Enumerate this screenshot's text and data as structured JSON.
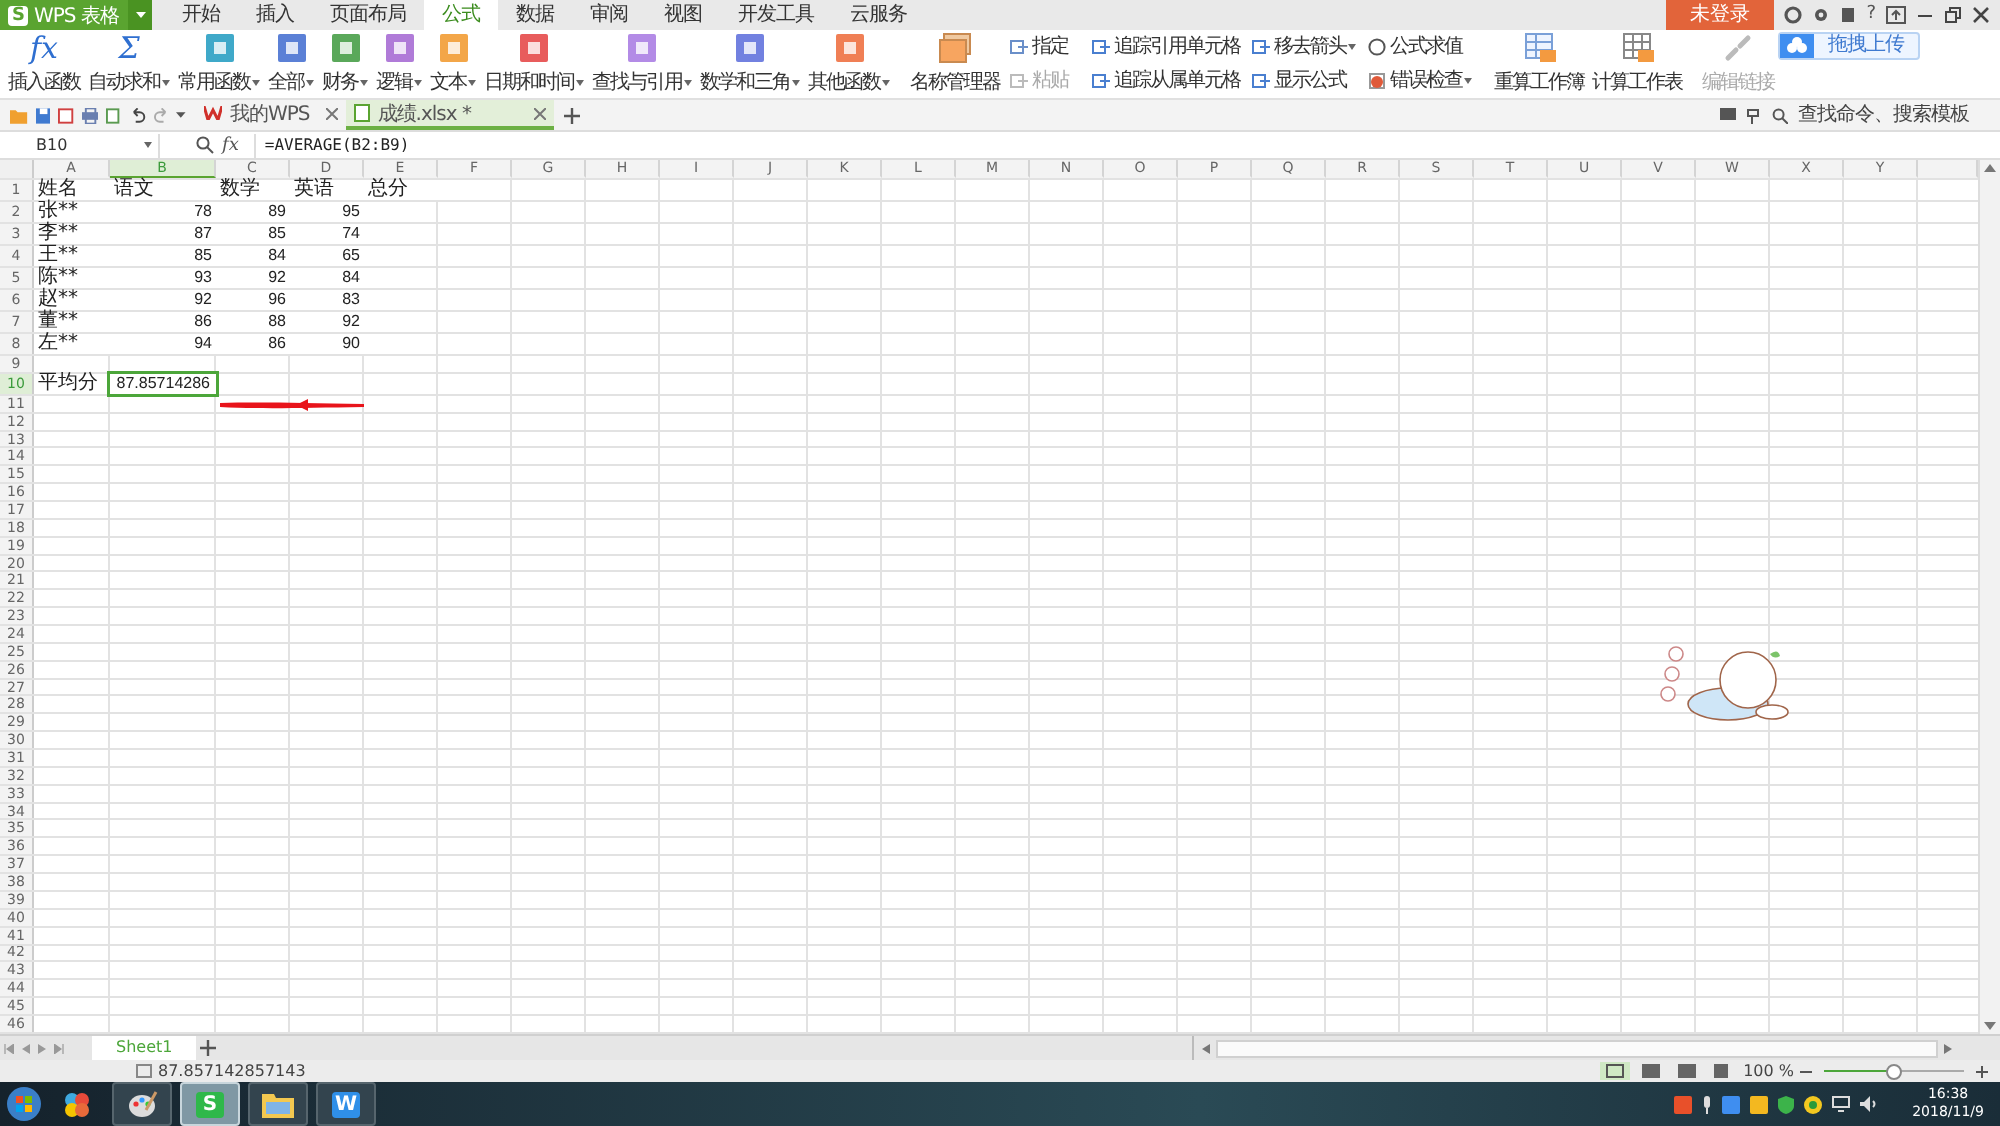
{
  "title_bar": {
    "brand_glyph": "S",
    "brand": "WPS 表格",
    "login": "未登录",
    "help": "?"
  },
  "menu_tabs": [
    {
      "label": "开始",
      "selected": false
    },
    {
      "label": "插入",
      "selected": false
    },
    {
      "label": "页面布局",
      "selected": false
    },
    {
      "label": "公式",
      "selected": true
    },
    {
      "label": "数据",
      "selected": false
    },
    {
      "label": "审阅",
      "selected": false
    },
    {
      "label": "视图",
      "selected": false
    },
    {
      "label": "开发工具",
      "selected": false
    },
    {
      "label": "云服务",
      "selected": false
    }
  ],
  "ribbon": [
    {
      "kind": "symbol",
      "icon_text": "fx",
      "label": "插入函数",
      "dropdown": false,
      "disabled": false
    },
    {
      "kind": "symbol",
      "icon_text": "Σ",
      "label": "自动求和",
      "dropdown": true,
      "disabled": false
    },
    {
      "kind": "category",
      "color": "#3fa9c9",
      "label": "常用函数",
      "dropdown": true,
      "disabled": false
    },
    {
      "kind": "category",
      "color": "#5b80d6",
      "label": "全部",
      "dropdown": true,
      "disabled": false
    },
    {
      "kind": "category",
      "color": "#5aa85a",
      "label": "财务",
      "dropdown": true,
      "disabled": false
    },
    {
      "kind": "category",
      "color": "#b07bd8",
      "label": "逻辑",
      "dropdown": true,
      "disabled": false
    },
    {
      "kind": "category",
      "color": "#f3a648",
      "label": "文本",
      "dropdown": true,
      "disabled": false
    },
    {
      "kind": "category",
      "color": "#e85c5c",
      "label": "日期和时间",
      "dropdown": true,
      "disabled": false
    },
    {
      "kind": "category",
      "color": "#b38be6",
      "label": "查找与引用",
      "dropdown": true,
      "disabled": false
    },
    {
      "kind": "category",
      "color": "#7281e0",
      "label": "数学和三角",
      "dropdown": true,
      "disabled": false
    },
    {
      "kind": "category",
      "color": "#f07f55",
      "label": "其他函数",
      "dropdown": true,
      "disabled": false
    },
    {
      "kind": "divider"
    },
    {
      "kind": "names",
      "label": "名称管理器",
      "dropdown": false,
      "disabled": false
    },
    {
      "kind": "stack",
      "items": [
        {
          "kind": "tag",
          "label": "指定",
          "dropdown": false,
          "disabled": false
        },
        {
          "kind": "paste",
          "label": "粘贴",
          "dropdown": false,
          "disabled": true
        }
      ]
    },
    {
      "kind": "divider"
    },
    {
      "kind": "stack",
      "items": [
        {
          "kind": "trace",
          "label": "追踪引用单元格",
          "dropdown": false,
          "disabled": false
        },
        {
          "kind": "trace",
          "label": "追踪从属单元格",
          "dropdown": false,
          "disabled": false
        }
      ]
    },
    {
      "kind": "stack",
      "items": [
        {
          "kind": "remove",
          "label": "移去箭头",
          "dropdown": true,
          "disabled": false
        },
        {
          "kind": "show",
          "label": "显示公式",
          "dropdown": false,
          "disabled": false
        }
      ]
    },
    {
      "kind": "stack",
      "items": [
        {
          "kind": "eval",
          "label": "公式求值",
          "dropdown": false,
          "disabled": false
        },
        {
          "kind": "error",
          "label": "错误检查",
          "dropdown": true,
          "disabled": false
        }
      ]
    },
    {
      "kind": "divider"
    },
    {
      "kind": "recalc",
      "label": "重算工作簿",
      "dropdown": false,
      "disabled": false
    },
    {
      "kind": "calc",
      "label": "计算工作表",
      "dropdown": false,
      "disabled": false
    },
    {
      "kind": "divider"
    },
    {
      "kind": "link",
      "label": "编辑链接",
      "dropdown": false,
      "disabled": true
    }
  ],
  "upload_button": "拖拽上传",
  "doc_tabs": [
    {
      "label": "我的WPS",
      "selected": false
    },
    {
      "label": "成绩.xlsx *",
      "selected": true
    }
  ],
  "search": {
    "placeholder": "查找命令、搜索模板"
  },
  "formula_bar": {
    "cell": "B10",
    "fx": "fx",
    "formula": "=AVERAGE(B2:B9)"
  },
  "sheet": {
    "columns": [
      {
        "label": "A",
        "selected": false
      },
      {
        "label": "B",
        "selected": true
      },
      {
        "label": "C",
        "selected": false
      },
      {
        "label": "D",
        "selected": false
      },
      {
        "label": "E",
        "selected": false
      },
      {
        "label": "F",
        "selected": false
      },
      {
        "label": "G",
        "selected": false
      },
      {
        "label": "H",
        "selected": false
      },
      {
        "label": "I",
        "selected": false
      },
      {
        "label": "J",
        "selected": false
      },
      {
        "label": "K",
        "selected": false
      },
      {
        "label": "L",
        "selected": false
      },
      {
        "label": "M",
        "selected": false
      },
      {
        "label": "N",
        "selected": false
      },
      {
        "label": "O",
        "selected": false
      },
      {
        "label": "P",
        "selected": false
      },
      {
        "label": "Q",
        "selected": false
      },
      {
        "label": "R",
        "selected": false
      },
      {
        "label": "S",
        "selected": false
      },
      {
        "label": "T",
        "selected": false
      },
      {
        "label": "U",
        "selected": false
      },
      {
        "label": "V",
        "selected": false
      },
      {
        "label": "W",
        "selected": false
      },
      {
        "label": "X",
        "selected": false
      },
      {
        "label": "Y",
        "selected": false
      }
    ],
    "rows": [
      {
        "label": "1",
        "selected": false,
        "cells": [
          {
            "text": "姓名",
            "kind": "text"
          },
          {
            "text": "语文",
            "kind": "text"
          },
          {
            "text": "数学",
            "kind": "text"
          },
          {
            "text": "英语",
            "kind": "text"
          },
          {
            "text": "总分",
            "kind": "text"
          }
        ]
      },
      {
        "label": "2",
        "selected": false,
        "cells": [
          {
            "text": "张**",
            "kind": "text"
          },
          {
            "text": "78",
            "kind": "number"
          },
          {
            "text": "89",
            "kind": "number"
          },
          {
            "text": "95",
            "kind": "number"
          }
        ]
      },
      {
        "label": "3",
        "selected": false,
        "cells": [
          {
            "text": "李**",
            "kind": "text"
          },
          {
            "text": "87",
            "kind": "number"
          },
          {
            "text": "85",
            "kind": "number"
          },
          {
            "text": "74",
            "kind": "number"
          }
        ]
      },
      {
        "label": "4",
        "selected": false,
        "cells": [
          {
            "text": "王**",
            "kind": "text"
          },
          {
            "text": "85",
            "kind": "number"
          },
          {
            "text": "84",
            "kind": "number"
          },
          {
            "text": "65",
            "kind": "number"
          }
        ]
      },
      {
        "label": "5",
        "selected": false,
        "cells": [
          {
            "text": "陈**",
            "kind": "text"
          },
          {
            "text": "93",
            "kind": "number"
          },
          {
            "text": "92",
            "kind": "number"
          },
          {
            "text": "84",
            "kind": "number"
          }
        ]
      },
      {
        "label": "6",
        "selected": false,
        "cells": [
          {
            "text": "赵**",
            "kind": "text"
          },
          {
            "text": "92",
            "kind": "number"
          },
          {
            "text": "96",
            "kind": "number"
          },
          {
            "text": "83",
            "kind": "number"
          }
        ]
      },
      {
        "label": "7",
        "selected": false,
        "cells": [
          {
            "text": "董**",
            "kind": "text"
          },
          {
            "text": "86",
            "kind": "number"
          },
          {
            "text": "88",
            "kind": "number"
          },
          {
            "text": "92",
            "kind": "number"
          }
        ]
      },
      {
        "label": "8",
        "selected": false,
        "cells": [
          {
            "text": "左**",
            "kind": "text"
          },
          {
            "text": "94",
            "kind": "number"
          },
          {
            "text": "86",
            "kind": "number"
          },
          {
            "text": "90",
            "kind": "number"
          }
        ]
      },
      {
        "label": "9",
        "selected": false
      },
      {
        "label": "10",
        "selected": true,
        "cells": [
          {
            "text": "平均分",
            "kind": "text"
          },
          {
            "text": "87.85714286",
            "kind": "number"
          }
        ]
      },
      {
        "label": "11",
        "selected": false,
        "kind": "arrow"
      },
      {
        "label": "12",
        "selected": false
      },
      {
        "label": "13",
        "selected": false
      },
      {
        "label": "14",
        "selected": false
      },
      {
        "label": "15",
        "selected": false
      },
      {
        "label": "16",
        "selected": false
      },
      {
        "label": "17",
        "selected": false
      },
      {
        "label": "18",
        "selected": false
      },
      {
        "label": "19",
        "selected": false
      },
      {
        "label": "20",
        "selected": false
      },
      {
        "label": "21",
        "selected": false
      },
      {
        "label": "22",
        "selected": false
      },
      {
        "label": "23",
        "selected": false
      },
      {
        "label": "24",
        "selected": false
      },
      {
        "label": "25",
        "selected": false
      },
      {
        "label": "26",
        "selected": false
      },
      {
        "label": "27",
        "selected": false
      },
      {
        "label": "28",
        "selected": false
      },
      {
        "label": "29",
        "selected": false
      },
      {
        "label": "30",
        "selected": false
      },
      {
        "label": "31",
        "selected": false
      },
      {
        "label": "32",
        "selected": false
      },
      {
        "label": "33",
        "selected": false
      },
      {
        "label": "34",
        "selected": false
      },
      {
        "label": "35",
        "selected": false
      },
      {
        "label": "36",
        "selected": false
      },
      {
        "label": "37",
        "selected": false
      },
      {
        "label": "38",
        "selected": false
      },
      {
        "label": "39",
        "selected": false
      },
      {
        "label": "40",
        "selected": false
      },
      {
        "label": "41",
        "selected": false
      },
      {
        "label": "42",
        "selected": false
      },
      {
        "label": "43",
        "selected": false
      },
      {
        "label": "44",
        "selected": false
      },
      {
        "label": "45",
        "selected": false
      },
      {
        "label": "46",
        "selected": false
      }
    ],
    "sticker": {
      "kind": "mascot"
    }
  },
  "sheet_tabs": [
    {
      "label": "Sheet1",
      "selected": true
    }
  ],
  "status_bar": {
    "sum": "87.857142857143",
    "zoom": {
      "reading": "100 %",
      "level": 0.5
    }
  },
  "taskbar": {
    "apps": [
      {
        "kind": "start"
      },
      {
        "kind": "flower"
      },
      {
        "kind": "paint",
        "active": false
      },
      {
        "kind": "glyph",
        "glyph": "S",
        "color": "#2fb84a",
        "active": true
      },
      {
        "kind": "folder",
        "active": false
      },
      {
        "kind": "glyph",
        "glyph": "W",
        "color": "#2f8fe8",
        "active": false
      }
    ],
    "time": "16:38",
    "date": "2018/11/9"
  }
}
